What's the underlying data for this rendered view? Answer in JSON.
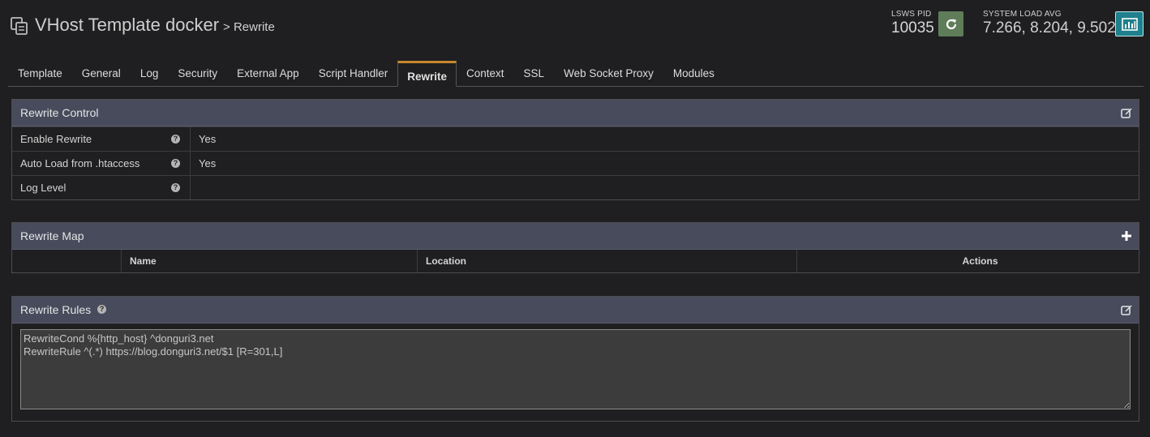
{
  "header": {
    "title": "VHost Template docker",
    "breadcrumb": "> Rewrite",
    "pid_label": "LSWS PID",
    "pid_value": "10035",
    "load_label": "SYSTEM LOAD AVG",
    "load_value": "7.266, 8.204, 9.502"
  },
  "tabs": [
    {
      "label": "Template"
    },
    {
      "label": "General"
    },
    {
      "label": "Log"
    },
    {
      "label": "Security"
    },
    {
      "label": "External App"
    },
    {
      "label": "Script Handler"
    },
    {
      "label": "Rewrite",
      "active": true
    },
    {
      "label": "Context"
    },
    {
      "label": "SSL"
    },
    {
      "label": "Web Socket Proxy"
    },
    {
      "label": "Modules"
    }
  ],
  "rewrite_control": {
    "title": "Rewrite Control",
    "rows": [
      {
        "label": "Enable Rewrite",
        "value": "Yes"
      },
      {
        "label": "Auto Load from .htaccess",
        "value": "Yes"
      },
      {
        "label": "Log Level",
        "value": ""
      }
    ]
  },
  "rewrite_map": {
    "title": "Rewrite Map",
    "columns": [
      "",
      "Name",
      "Location",
      "Actions"
    ]
  },
  "rewrite_rules": {
    "title": "Rewrite Rules",
    "content": "RewriteCond %{http_host} ^donguri3.net\nRewriteRule ^(.*) https://blog.donguri3.net/$1 [R=301,L]"
  },
  "colors": {
    "background": "#1f1f21",
    "panel_header": "#484b5c",
    "active_tab_accent": "#c8872d",
    "restart_button": "#5f7d59",
    "stats_button": "#1f7f8c"
  },
  "icons": {
    "title": "copy-icon",
    "restart": "refresh-icon",
    "stats": "bar-chart-icon",
    "edit": "edit-icon",
    "add": "plus-icon",
    "help": "question-circle-icon"
  }
}
